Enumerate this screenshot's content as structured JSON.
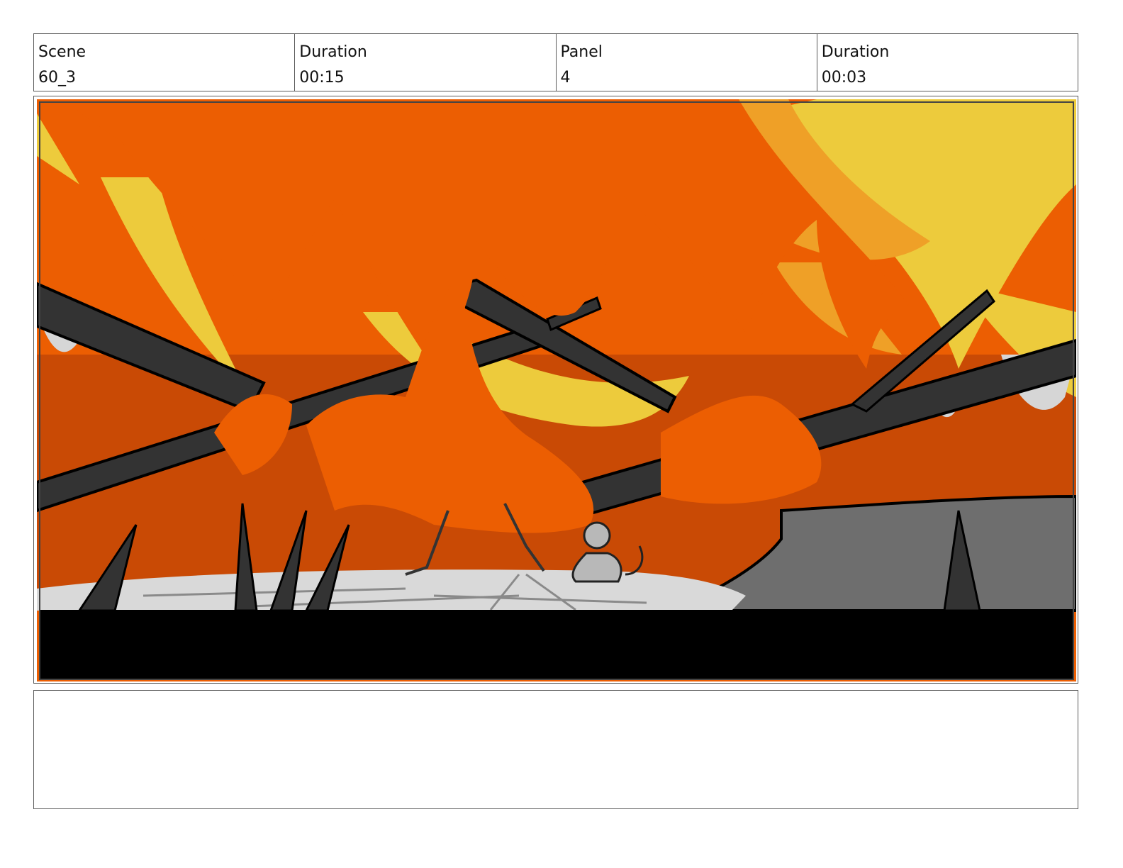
{
  "header": {
    "scene_label": "Scene",
    "scene_value": "60_3",
    "scene_duration_label": "Duration",
    "scene_duration_value": "00:15",
    "panel_label": "Panel",
    "panel_value": "4",
    "panel_duration_label": "Duration",
    "panel_duration_value": "00:03"
  },
  "artwork": {
    "description_icon": "fire-scene-illustration",
    "colors": {
      "flame_orange": "#EC5E02",
      "flame_amber": "#EFA027",
      "flame_yellow": "#EDCB3C",
      "ember": "#C94A05",
      "branch": "#333333",
      "ground": "#D9D9D9",
      "rock": "#6E6E6E",
      "letterbox": "#000000"
    }
  },
  "notes": {
    "text": ""
  }
}
